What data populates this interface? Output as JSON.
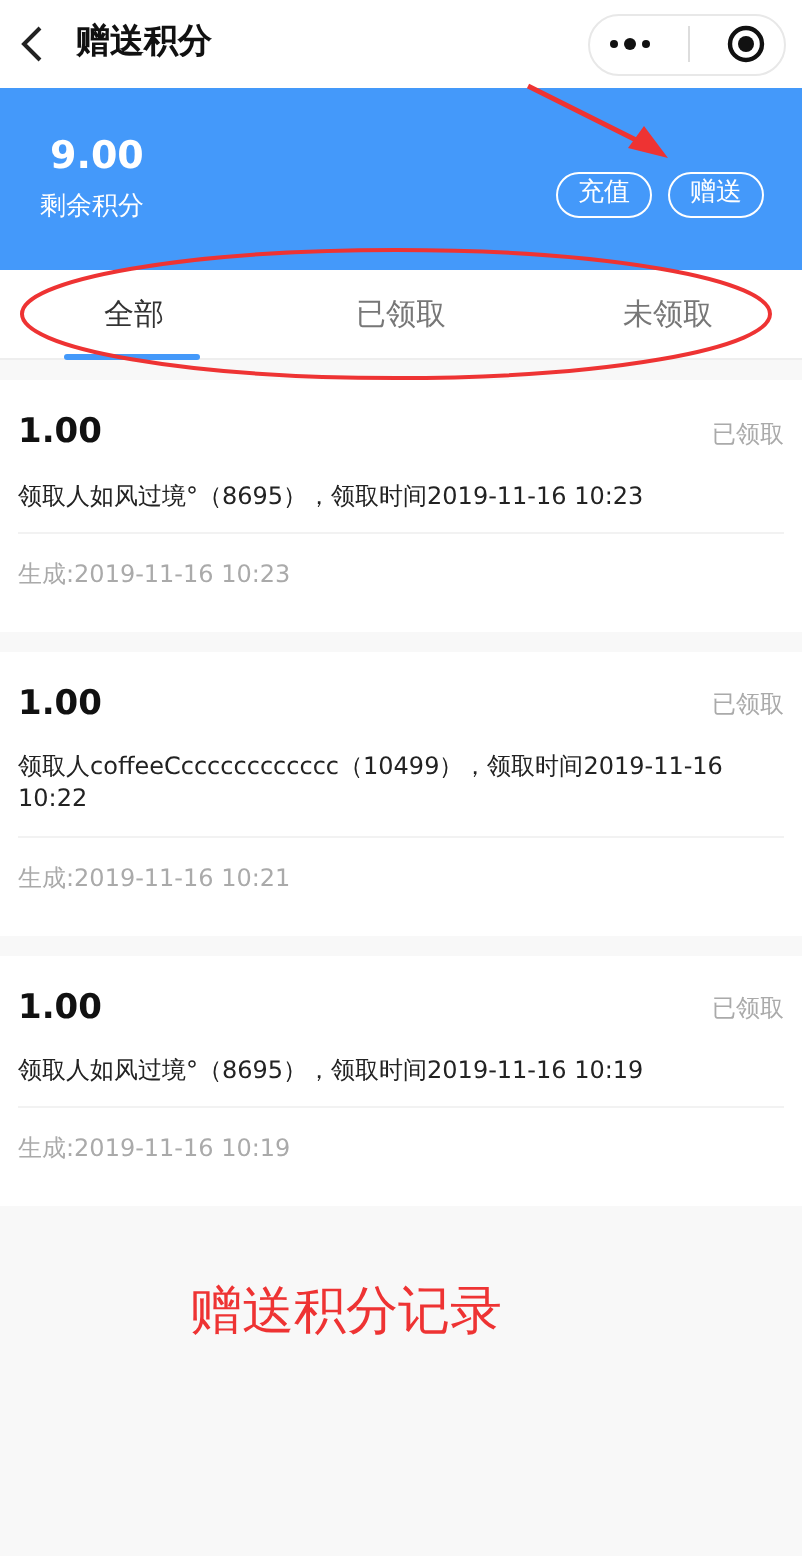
{
  "header": {
    "title": "赠送积分"
  },
  "summary": {
    "balance": "9.00",
    "label": "剩余积分",
    "buttons": [
      "充值",
      "赠送"
    ]
  },
  "tabs": [
    {
      "label": "全部",
      "selected": true
    },
    {
      "label": "已领取",
      "selected": false
    },
    {
      "label": "未领取",
      "selected": false
    }
  ],
  "records": [
    {
      "amount": "1.00",
      "status": "已领取",
      "detail": "领取人如风过境°（8695），领取时间2019-11-16 10:23",
      "created": "生成:2019-11-16 10:23"
    },
    {
      "amount": "1.00",
      "status": "已领取",
      "detail": "领取人coffeeCcccccccccccc（10499），领取时间2019-11-16 10:22",
      "created": "生成:2019-11-16 10:21"
    },
    {
      "amount": "1.00",
      "status": "已领取",
      "detail": "领取人如风过境°（8695），领取时间2019-11-16 10:19",
      "created": "生成:2019-11-16 10:19"
    }
  ],
  "annotation": {
    "caption": "赠送积分记录"
  }
}
